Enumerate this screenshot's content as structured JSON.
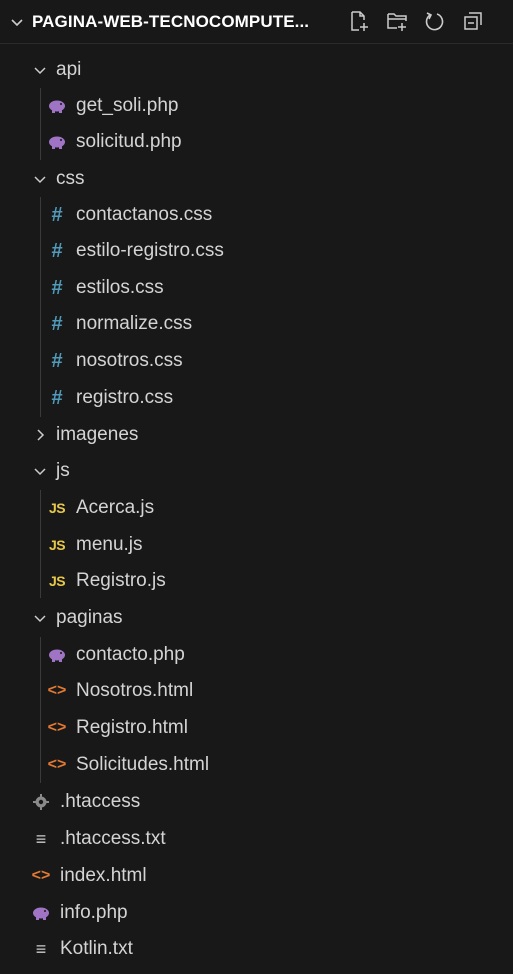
{
  "explorer": {
    "title": "PAGINA-WEB-TECNOCOMPUTE...",
    "actions": [
      {
        "name": "new-file-icon"
      },
      {
        "name": "new-folder-icon"
      },
      {
        "name": "refresh-icon"
      },
      {
        "name": "collapse-all-icon"
      }
    ],
    "tree": [
      {
        "label": "api",
        "type": "folder",
        "expanded": true
      },
      {
        "label": "get_soli.php",
        "type": "php"
      },
      {
        "label": "solicitud.php",
        "type": "php"
      },
      {
        "label": "css",
        "type": "folder",
        "expanded": true
      },
      {
        "label": "contactanos.css",
        "type": "css"
      },
      {
        "label": "estilo-registro.css",
        "type": "css"
      },
      {
        "label": "estilos.css",
        "type": "css"
      },
      {
        "label": "normalize.css",
        "type": "css"
      },
      {
        "label": "nosotros.css",
        "type": "css"
      },
      {
        "label": "registro.css",
        "type": "css"
      },
      {
        "label": "imagenes",
        "type": "folder",
        "expanded": false
      },
      {
        "label": "js",
        "type": "folder",
        "expanded": true
      },
      {
        "label": "Acerca.js",
        "type": "js"
      },
      {
        "label": "menu.js",
        "type": "js"
      },
      {
        "label": "Registro.js",
        "type": "js"
      },
      {
        "label": "paginas",
        "type": "folder",
        "expanded": true
      },
      {
        "label": "contacto.php",
        "type": "php"
      },
      {
        "label": "Nosotros.html",
        "type": "html"
      },
      {
        "label": "Registro.html",
        "type": "html"
      },
      {
        "label": "Solicitudes.html",
        "type": "html"
      },
      {
        "label": ".htaccess",
        "type": "config"
      },
      {
        "label": ".htaccess.txt",
        "type": "text"
      },
      {
        "label": "index.html",
        "type": "html"
      },
      {
        "label": "info.php",
        "type": "php"
      },
      {
        "label": "Kotlin.txt",
        "type": "text"
      }
    ],
    "icon_glyphs": {
      "css": "#",
      "js": "JS",
      "html": "<>",
      "text": "≡"
    }
  }
}
